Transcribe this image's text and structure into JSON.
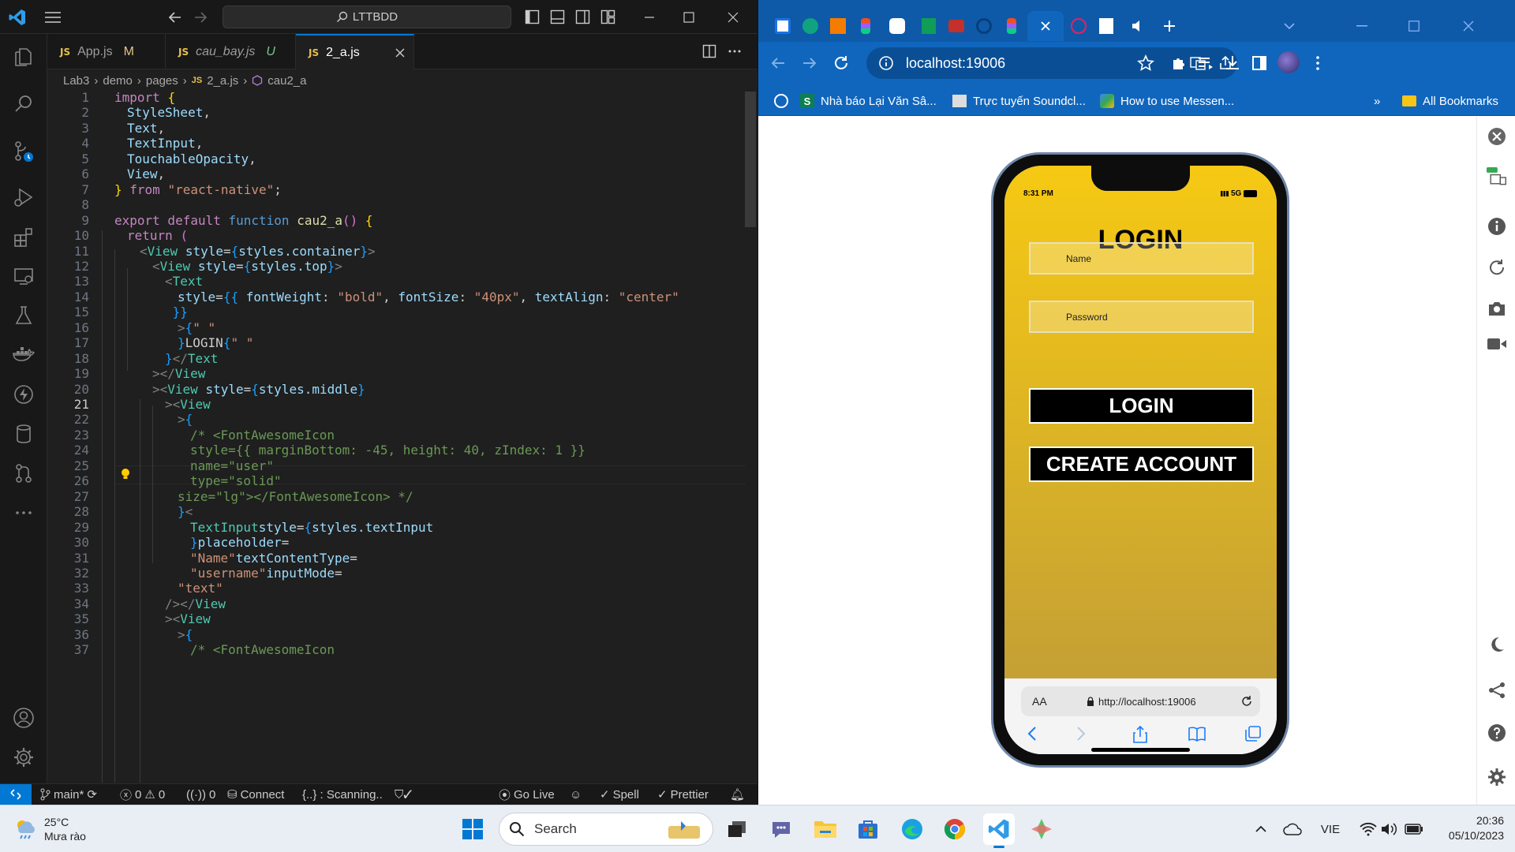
{
  "vscode": {
    "search": "LTTBDD",
    "tabs": [
      {
        "name": "App.js",
        "status": "M"
      },
      {
        "name": "cau_bay.js",
        "status": "U"
      },
      {
        "name": "2_a.js",
        "status": ""
      }
    ],
    "tab_icon": "JS",
    "breadcrumb": [
      "Lab3",
      "demo",
      "pages",
      "2_a.js",
      "cau2_a"
    ],
    "line_numbers": [
      "1",
      "2",
      "3",
      "4",
      "5",
      "6",
      "7",
      "8",
      "9",
      "10",
      "11",
      "12",
      "13",
      "14",
      "15",
      "16",
      "17",
      "18",
      "19",
      "20",
      "21",
      "22",
      "23",
      "24",
      "25",
      "26",
      "27",
      "28",
      "29",
      "30",
      "31",
      "32",
      "33",
      "34",
      "35",
      "36",
      "37"
    ],
    "current_line": "21",
    "code": [
      {
        "t": "import ",
        "c": "k"
      },
      {
        "t": "{",
        "c": "y"
      },
      {
        "t": "StyleSheet",
        "c": "v"
      },
      {
        "t": ",",
        "c": ""
      },
      {
        "t": "Text",
        "c": "v"
      },
      {
        "t": ",",
        "c": ""
      },
      {
        "t": "TextInput",
        "c": "v"
      },
      {
        "t": ",",
        "c": ""
      },
      {
        "t": "TouchableOpacity",
        "c": "v"
      },
      {
        "t": ",",
        "c": ""
      },
      {
        "t": "View",
        "c": "v"
      },
      {
        "t": ",",
        "c": ""
      },
      {
        "t": "}",
        "c": "y"
      },
      {
        "t": " from ",
        "c": "k"
      },
      {
        "t": "\"react-native\"",
        "c": "s"
      },
      {
        "t": ";",
        "c": ""
      },
      {
        "t": "export default ",
        "c": "k"
      },
      {
        "t": "function ",
        "c": "kw"
      },
      {
        "t": "cau2_a",
        "c": "f"
      },
      {
        "t": "() ",
        "c": "pk"
      },
      {
        "t": "{",
        "c": "y"
      },
      {
        "t": "return ",
        "c": "k"
      },
      {
        "t": "(",
        "c": "pk"
      },
      {
        "t": "<",
        "c": "p"
      },
      {
        "t": "View ",
        "c": "t"
      },
      {
        "t": "style",
        "c": "v"
      },
      {
        "t": "=",
        "c": ""
      },
      {
        "t": "{",
        "c": "bl"
      },
      {
        "t": "styles.container",
        "c": "v"
      },
      {
        "t": "}",
        "c": "bl"
      },
      {
        "t": ">",
        "c": "p"
      },
      {
        "t": "<",
        "c": "p"
      },
      {
        "t": "View ",
        "c": "t"
      },
      {
        "t": "style",
        "c": "v"
      },
      {
        "t": "=",
        "c": ""
      },
      {
        "t": "{",
        "c": "bl"
      },
      {
        "t": "styles.top",
        "c": "v"
      },
      {
        "t": "}",
        "c": "bl"
      },
      {
        "t": ">",
        "c": "p"
      },
      {
        "t": "<",
        "c": "p"
      },
      {
        "t": "Text",
        "c": "t"
      },
      {
        "t": "style",
        "c": "v"
      },
      {
        "t": "=",
        "c": ""
      },
      {
        "t": "{{ ",
        "c": "bl"
      },
      {
        "t": "fontWeight",
        "c": "v"
      },
      {
        "t": ": ",
        "c": ""
      },
      {
        "t": "\"bold\"",
        "c": "s"
      },
      {
        "t": ", ",
        "c": ""
      },
      {
        "t": "fontSize",
        "c": "v"
      },
      {
        "t": ": ",
        "c": ""
      },
      {
        "t": "\"40px\"",
        "c": "s"
      },
      {
        "t": ", ",
        "c": ""
      },
      {
        "t": "textAlign",
        "c": "v"
      },
      {
        "t": ": ",
        "c": ""
      },
      {
        "t": "\"center\"",
        "c": "s"
      },
      {
        "t": " }}",
        "c": "bl"
      },
      {
        "t": ">",
        "c": "p"
      },
      {
        "t": "{",
        "c": "bl"
      },
      {
        "t": "\" \"",
        "c": "s"
      },
      {
        "t": "}",
        "c": "bl"
      },
      {
        "t": "LOGIN",
        "c": ""
      },
      {
        "t": "{",
        "c": "bl"
      },
      {
        "t": "\" \"",
        "c": "s"
      },
      {
        "t": "}",
        "c": "bl"
      },
      {
        "t": "</",
        "c": "p"
      },
      {
        "t": "Text",
        "c": "t"
      },
      {
        "t": ">",
        "c": "p"
      },
      {
        "t": "</",
        "c": "p"
      },
      {
        "t": "View",
        "c": "t"
      },
      {
        "t": ">",
        "c": "p"
      },
      {
        "t": "<",
        "c": "p"
      },
      {
        "t": "View ",
        "c": "t"
      },
      {
        "t": "style",
        "c": "v"
      },
      {
        "t": "=",
        "c": ""
      },
      {
        "t": "{",
        "c": "bl"
      },
      {
        "t": "styles.middle",
        "c": "v"
      },
      {
        "t": "}",
        "c": "bl"
      },
      {
        "t": ">",
        "c": "p"
      },
      {
        "t": "<",
        "c": "p"
      },
      {
        "t": "View",
        "c": "t"
      },
      {
        "t": ">",
        "c": "p"
      },
      {
        "t": "{",
        "c": "bl"
      },
      {
        "t": "/* <FontAwesomeIcon",
        "c": "c"
      },
      {
        "t": "style={{ marginBottom: -45, height: 40, zIndex: 1 }}",
        "c": "c"
      },
      {
        "t": "name=\"user\"",
        "c": "c"
      },
      {
        "t": "type=\"solid\"",
        "c": "c"
      },
      {
        "t": "size=\"lg\"",
        "c": "c"
      },
      {
        "t": "></FontAwesomeIcon> */",
        "c": "c"
      },
      {
        "t": "}",
        "c": "bl"
      },
      {
        "t": "<",
        "c": "p"
      },
      {
        "t": "TextInput",
        "c": "t"
      },
      {
        "t": "style",
        "c": "v"
      },
      {
        "t": "=",
        "c": ""
      },
      {
        "t": "{",
        "c": "bl"
      },
      {
        "t": "styles.textInput",
        "c": "v"
      },
      {
        "t": "}",
        "c": "bl"
      },
      {
        "t": "placeholder",
        "c": "v"
      },
      {
        "t": "=",
        "c": ""
      },
      {
        "t": "\"Name\"",
        "c": "s"
      },
      {
        "t": "textContentType",
        "c": "v"
      },
      {
        "t": "=",
        "c": ""
      },
      {
        "t": "\"username\"",
        "c": "s"
      },
      {
        "t": "inputMode",
        "c": "v"
      },
      {
        "t": "=",
        "c": ""
      },
      {
        "t": "\"text\"",
        "c": "s"
      },
      {
        "t": "/>",
        "c": "p"
      },
      {
        "t": "</",
        "c": "p"
      },
      {
        "t": "View",
        "c": "t"
      },
      {
        "t": ">",
        "c": "p"
      },
      {
        "t": "<",
        "c": "p"
      },
      {
        "t": "View",
        "c": "t"
      },
      {
        "t": ">",
        "c": "p"
      },
      {
        "t": "{",
        "c": "bl"
      },
      {
        "t": "/* <FontAwesomeIcon",
        "c": "c"
      },
      {
        "t": "style={{ marginBottom: -45, height: 40, zIndex: 1 }}",
        "c": "c"
      }
    ],
    "status": {
      "branch": "main*",
      "errors": "0",
      "warnings": "0",
      "ports": "0",
      "connect": "Connect",
      "scanning": "{..} : Scanning..",
      "golive": "Go Live",
      "spell": "Spell",
      "prettier": "Prettier"
    }
  },
  "browser": {
    "url": "localhost:19006",
    "bookmarks": [
      "Nhà báo Lại Văn Sâ...",
      "Trực tuyến Soundcl...",
      "How to use Messen..."
    ],
    "all_bookmarks": "All Bookmarks",
    "more": "»"
  },
  "phone": {
    "time": "8:31 PM",
    "signal": "5G",
    "title": "LOGIN",
    "name_placeholder": "Name",
    "password_placeholder": "Password",
    "login_button": "LOGIN",
    "create_button": "CREATE ACCOUNT",
    "safari_aa": "AA",
    "safari_url": "http://localhost:19006"
  },
  "taskbar": {
    "temp": "25°C",
    "weather": "Mưa rào",
    "search": "Search",
    "lang": "VIE",
    "time": "20:36",
    "date": "05/10/2023"
  }
}
